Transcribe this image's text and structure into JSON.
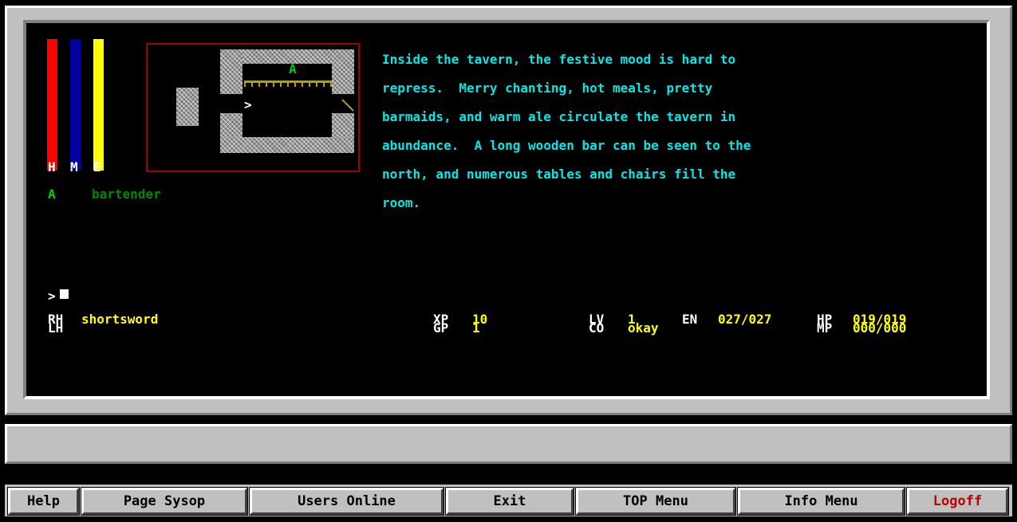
{
  "colors": {
    "health_bar": "#ff0000",
    "mana_bar": "#0000a0",
    "energy_bar": "#ffff00",
    "description_text": "#00e8e8",
    "value_text": "#ffff00",
    "label_text": "#ffffff",
    "npc_marker": "#00d000",
    "npc_name": "#008800",
    "logoff_text": "#c00000"
  },
  "gauges": {
    "labels": [
      "H",
      "M",
      "E"
    ],
    "health_fraction": 1.0,
    "mana_fraction": 1.0,
    "energy_fraction": 1.0
  },
  "map": {
    "npc_marker": "A",
    "player_marker": ">"
  },
  "room_description": [
    "Inside the tavern, the festive mood is hard to",
    "repress.  Merry chanting, hot meals, pretty",
    "barmaids, and warm ale circulate the tavern in",
    "abundance.  A long wooden bar can be seen to the",
    "north, and numerous tables and chairs fill the",
    "room."
  ],
  "occupants": [
    {
      "marker": "A",
      "name": "bartender"
    }
  ],
  "prompt": ">",
  "stats": {
    "rh_label": "RH",
    "rh_value": "shortsword",
    "lh_label": "LH",
    "lh_value": "",
    "xp_label": "XP",
    "xp_value": "10",
    "gp_label": "GP",
    "gp_value": "1",
    "lv_label": "LV",
    "lv_value": "1",
    "co_label": "CO",
    "co_value": "okay",
    "en_label": "EN",
    "en_value": "027/027",
    "hp_label": "HP",
    "hp_value": "019/019",
    "mp_label": "MP",
    "mp_value": "000/000"
  },
  "status_bar": {
    "text": ""
  },
  "toolbar": {
    "help": "Help",
    "page_sysop": "Page Sysop",
    "users_online": "Users Online",
    "exit": "Exit",
    "top_menu": "TOP Menu",
    "info_menu": "Info Menu",
    "logoff": "Logoff"
  }
}
